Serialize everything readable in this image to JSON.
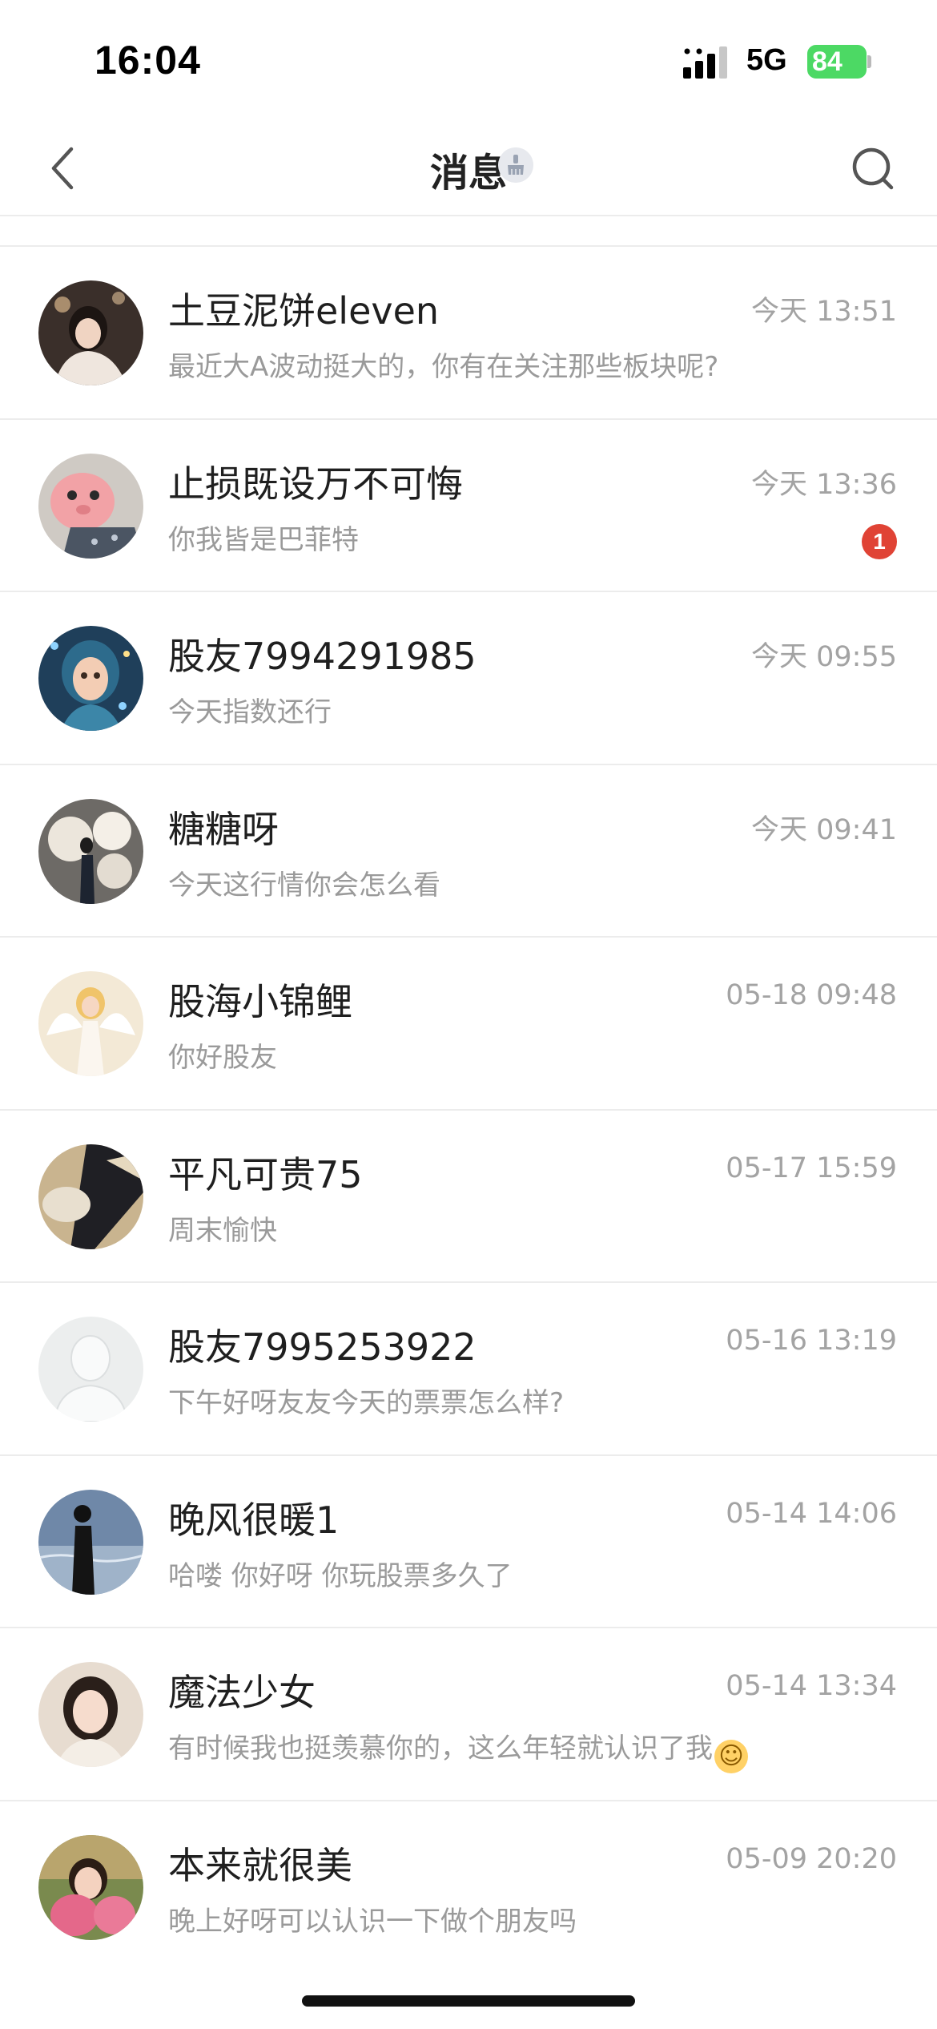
{
  "status_bar": {
    "time": "16:04",
    "network": "5G",
    "battery_level": "84",
    "icons": [
      "signal-icon",
      "battery-charging-icon"
    ]
  },
  "nav": {
    "title": "消息",
    "icons": [
      "back-icon",
      "clear-broom-icon",
      "search-icon"
    ]
  },
  "colors": {
    "badge": "#e04335",
    "battery": "#4cd964",
    "preview_text": "#9a9a9a"
  },
  "conversations": [
    {
      "name": "土豆泥饼eleven",
      "time": "今天 13:51",
      "preview": "最近大A波动挺大的，你有在关注那些板块呢?",
      "unread": null
    },
    {
      "name": "止损既设万不可悔",
      "time": "今天 13:36",
      "preview": "你我皆是巴菲特",
      "unread": "1"
    },
    {
      "name": "股友7994291985",
      "time": "今天 09:55",
      "preview": "今天指数还行",
      "unread": null
    },
    {
      "name": "糖糖呀",
      "time": "今天 09:41",
      "preview": "今天这行情你会怎么看",
      "unread": null
    },
    {
      "name": "股海小锦鲤",
      "time": "05-18 09:48",
      "preview": "你好股友",
      "unread": null
    },
    {
      "name": "平凡可贵75",
      "time": "05-17 15:59",
      "preview": "周末愉快",
      "unread": null
    },
    {
      "name": "股友7995253922",
      "time": "05-16 13:19",
      "preview": "下午好呀友友今天的票票怎么样?",
      "unread": null
    },
    {
      "name": "晚风很暖1",
      "time": "05-14 14:06",
      "preview": "哈喽 你好呀 你玩股票多久了",
      "unread": null
    },
    {
      "name": "魔法少女",
      "time": "05-14 13:34",
      "preview": "有时候我也挺羡慕你的，这么年轻就认识了我",
      "unread": null
    },
    {
      "name": "本来就很美",
      "time": "05-09 20:20",
      "preview": "晚上好呀可以认识一下做个朋友吗",
      "unread": null
    }
  ]
}
